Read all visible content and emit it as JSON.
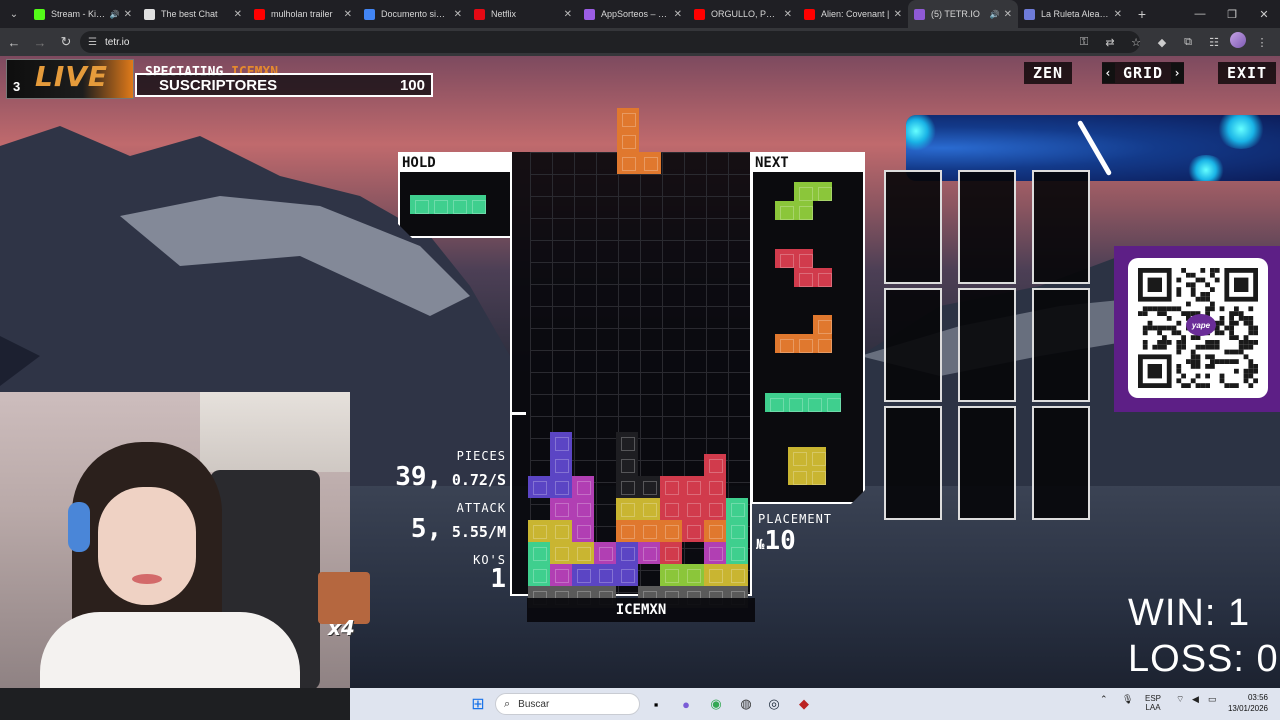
{
  "browser": {
    "tabs": [
      {
        "label": "Stream - Kick Dashboard",
        "favicon_color": "#53fc18",
        "muted": true
      },
      {
        "label": "The best Chat",
        "favicon_color": "#e0e0e0"
      },
      {
        "label": "mulholan trailer",
        "favicon_color": "#ff0000"
      },
      {
        "label": "Documento sin título",
        "favicon_color": "#4285f4"
      },
      {
        "label": "Netflix",
        "favicon_color": "#e50914"
      },
      {
        "label": "AppSorteos – La F",
        "favicon_color": "#9b5de5"
      },
      {
        "label": "ORGULLO, PREJUICIO",
        "favicon_color": "#ff0000"
      },
      {
        "label": "Alien: Covenant |",
        "favicon_color": "#ff0000"
      },
      {
        "label": "(5) TETR.IO",
        "favicon_color": "#8f5ad6",
        "active": true,
        "sound": true
      },
      {
        "label": "La Ruleta Aleatoria",
        "favicon_color": "#6e7bd9"
      }
    ],
    "url": "tetr.io"
  },
  "stream_overlay": {
    "live_label": "LIVE",
    "live_number": "3",
    "subs_label": "SUSCRIPTORES",
    "subs_count": "100"
  },
  "game": {
    "spectating_prefix": "SPECTATING",
    "spectating_name": "ICEMXN",
    "top_buttons": {
      "zen": "ZEN",
      "grid": "GRID",
      "exit": "EXIT"
    },
    "hold_label": "HOLD",
    "next_label": "NEXT",
    "player_name": "ICEMXN",
    "stats": {
      "pieces_label": "PIECES",
      "pieces_value": "39,",
      "pieces_rate": "0.72/S",
      "attack_label": "ATTACK",
      "attack_value": "5,",
      "attack_rate": "5.55/M",
      "kos_label": "KO'S",
      "kos_value": "1"
    },
    "placement_label": "PLACEMENT",
    "placement_prefix": "№",
    "placement_value": "10",
    "colors": {
      "I": "#3fcf8e",
      "O": "#c9b531",
      "T": "#b13fb3",
      "L": "#e0782e",
      "J": "#5b45c4",
      "S": "#8bc63a",
      "Z": "#d13b4c",
      "G": "#5a5a5a"
    }
  },
  "scoreboard": {
    "win": "WIN: 1",
    "loss": "LOSS: 0"
  },
  "qr": {
    "brand": "yape"
  },
  "emote": {
    "multiplier": "x4"
  },
  "taskbar": {
    "search_placeholder": "Buscar",
    "lang_top": "ESP",
    "lang_bottom": "LAA",
    "time": "03:56",
    "date": "13/01/2026"
  }
}
